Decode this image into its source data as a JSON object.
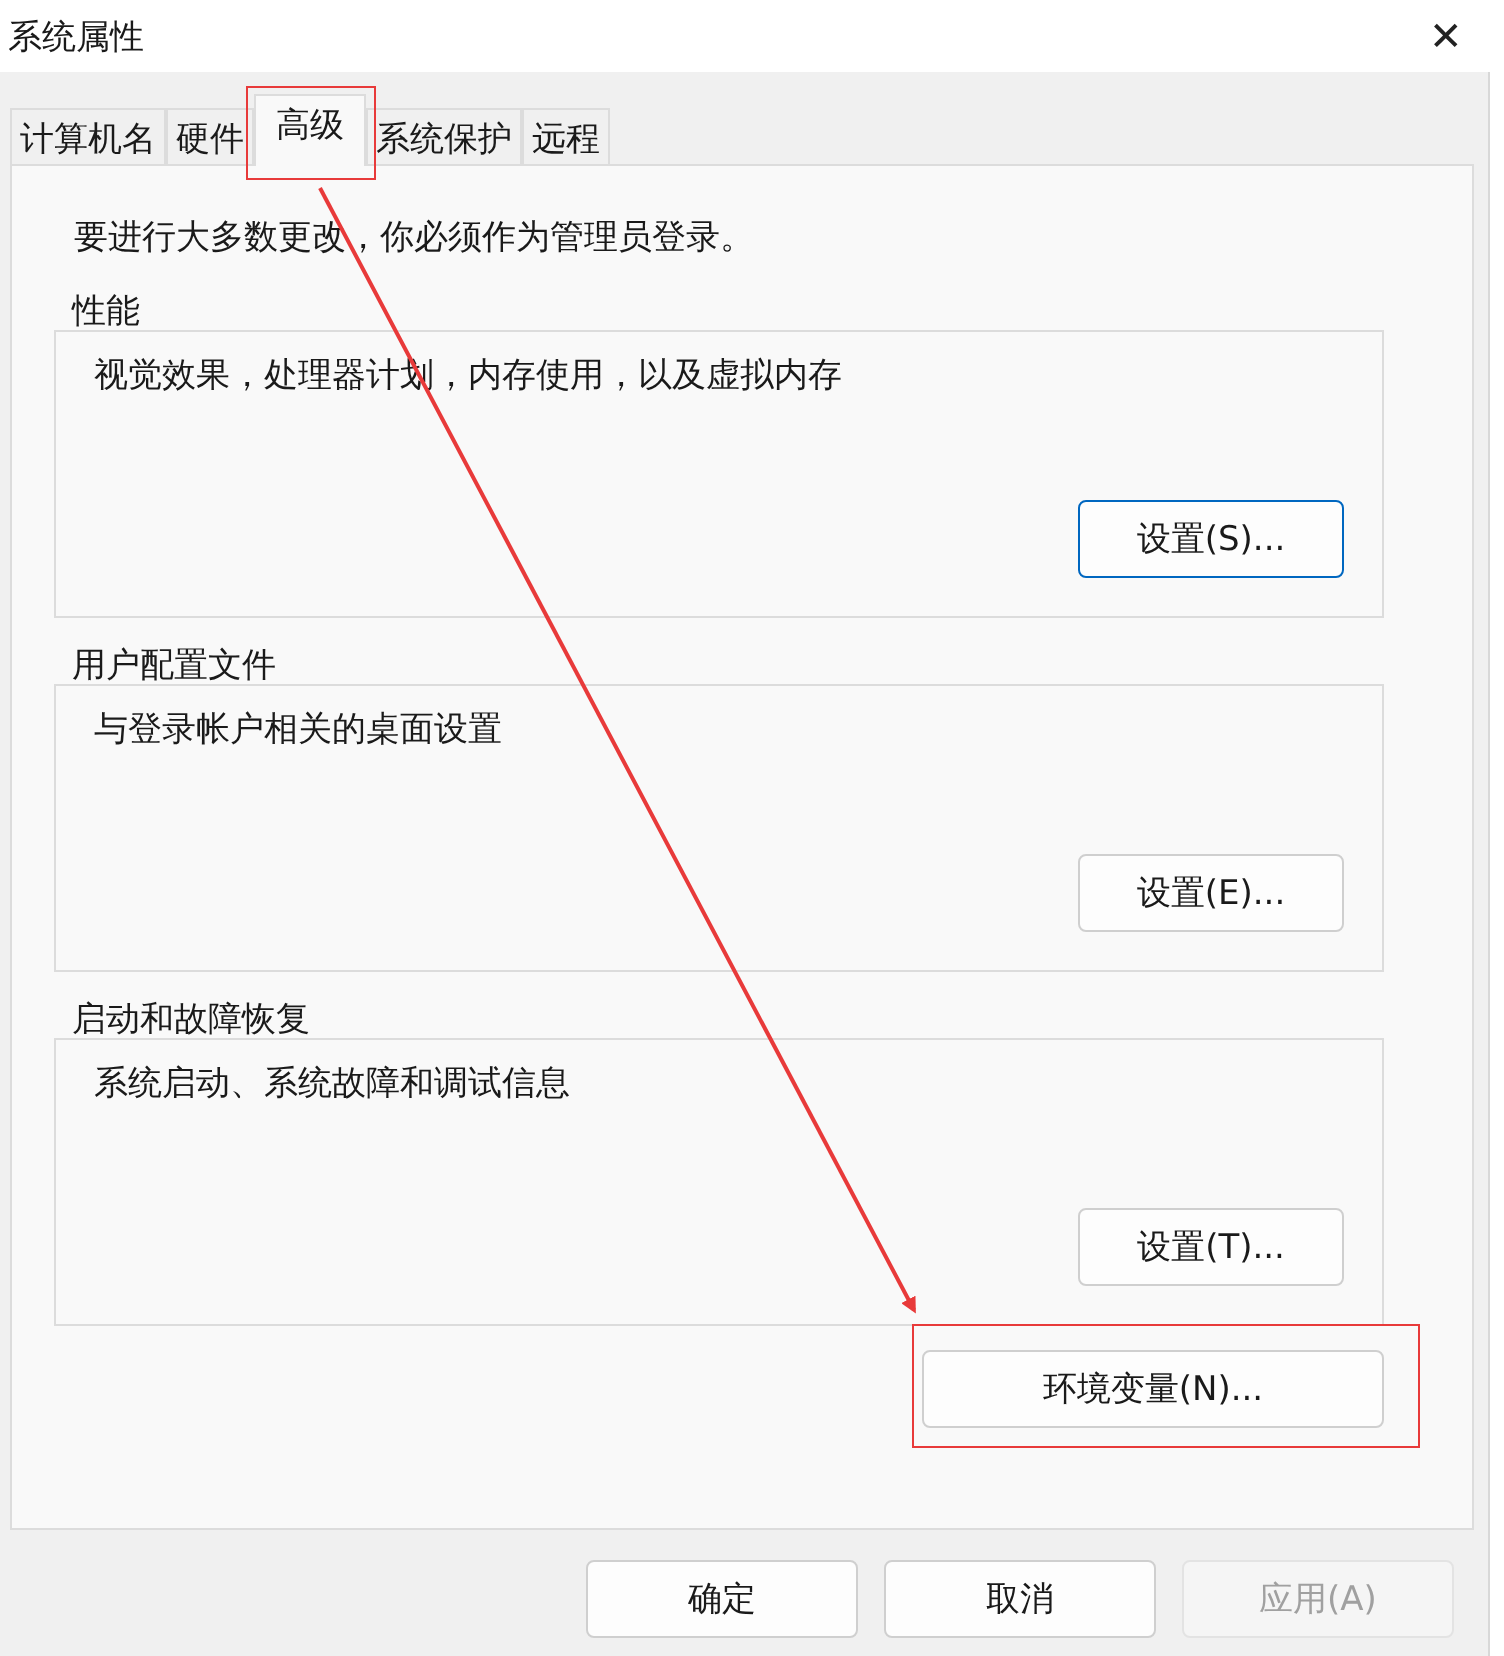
{
  "window": {
    "title": "系统属性",
    "close": "✕"
  },
  "tabs": [
    {
      "label": "计算机名",
      "selected": false
    },
    {
      "label": "硬件",
      "selected": false
    },
    {
      "label": "高级",
      "selected": true
    },
    {
      "label": "系统保护",
      "selected": false
    },
    {
      "label": "远程",
      "selected": false
    }
  ],
  "notice": "要进行大多数更改，你必须作为管理员登录。",
  "groups": [
    {
      "title": "性能",
      "description": "视觉效果，处理器计划，内存使用，以及虚拟内存",
      "button": "设置(S)...",
      "focused": true
    },
    {
      "title": "用户配置文件",
      "description": "与登录帐户相关的桌面设置",
      "button": "设置(E)...",
      "focused": false
    },
    {
      "title": "启动和故障恢复",
      "description": "系统启动、系统故障和调试信息",
      "button": "设置(T)...",
      "focused": false
    }
  ],
  "env_button": "环境变量(N)...",
  "buttons": [
    {
      "label": "确定",
      "disabled": false
    },
    {
      "label": "取消",
      "disabled": false
    },
    {
      "label": "应用(A)",
      "disabled": true
    }
  ]
}
